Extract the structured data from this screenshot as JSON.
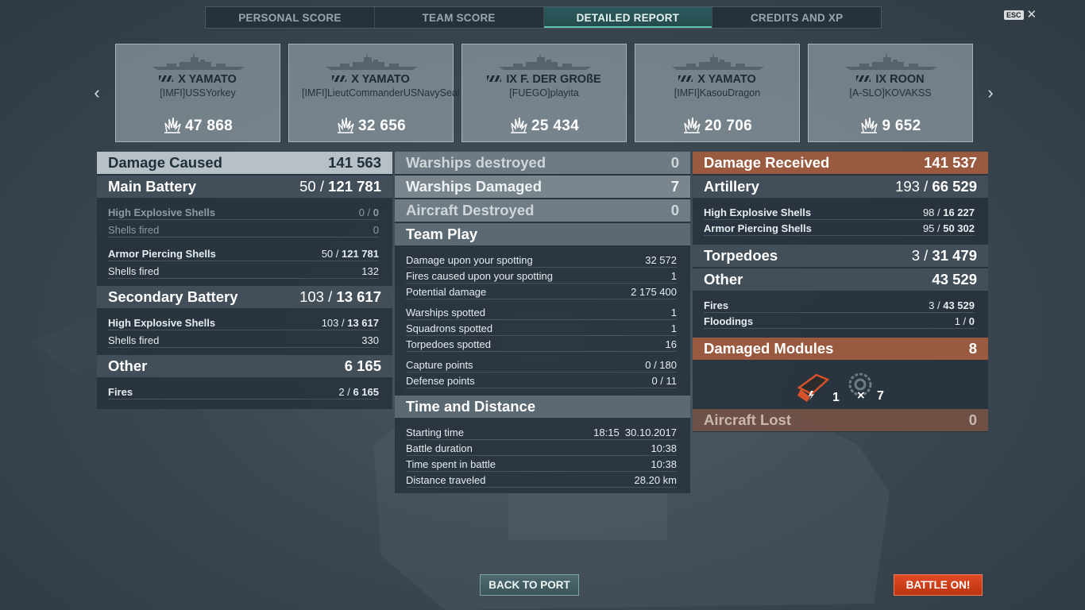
{
  "tabs": [
    "PERSONAL SCORE",
    "TEAM SCORE",
    "DETAILED REPORT",
    "CREDITS AND XP"
  ],
  "esc": {
    "key": "ESC",
    "close": "✕"
  },
  "nav": {
    "prev": "‹",
    "next": "›"
  },
  "players": [
    {
      "ship": "X YAMATO",
      "name": "[IMFI]USSYorkey",
      "damage": "47 868"
    },
    {
      "ship": "X YAMATO",
      "name": "[IMFI]LieutCommanderUSNavySeal",
      "damage": "32 656"
    },
    {
      "ship": "IX F. DER GROßE",
      "name": "[FUEGO]playita",
      "damage": "25 434"
    },
    {
      "ship": "X YAMATO",
      "name": "[IMFI]KasouDragon",
      "damage": "20 706"
    },
    {
      "ship": "IX ROON",
      "name": "[A-SLO]KOVAKSS",
      "damage": "9 652"
    }
  ],
  "left": {
    "damage_caused": {
      "label": "Damage Caused",
      "value": "141 563"
    },
    "main_battery": {
      "label": "Main Battery",
      "hits": "50 / ",
      "value": "121 781"
    },
    "he_main": {
      "label": "High Explosive Shells",
      "hits": "0 / ",
      "value": "0"
    },
    "he_main_fired": {
      "label": "Shells fired",
      "value": "0"
    },
    "ap_main": {
      "label": "Armor Piercing Shells",
      "hits": "50 / ",
      "value": "121 781"
    },
    "ap_main_fired": {
      "label": "Shells fired",
      "value": "132"
    },
    "secondary": {
      "label": "Secondary Battery",
      "hits": "103 / ",
      "value": "13 617"
    },
    "he_sec": {
      "label": "High Explosive Shells",
      "hits": "103 / ",
      "value": "13 617"
    },
    "he_sec_fired": {
      "label": "Shells fired",
      "value": "330"
    },
    "other": {
      "label": "Other",
      "value": "6 165"
    },
    "fires": {
      "label": "Fires",
      "hits": "2 / ",
      "value": "6 165"
    }
  },
  "middle": {
    "warships_destroyed": {
      "label": "Warships destroyed",
      "value": "0"
    },
    "warships_damaged": {
      "label": "Warships Damaged",
      "value": "7"
    },
    "aircraft_destroyed": {
      "label": "Aircraft Destroyed",
      "value": "0"
    },
    "team_play": "Team Play",
    "tp_rows": [
      {
        "label": "Damage upon your spotting",
        "value": "32 572"
      },
      {
        "label": "Fires caused upon your spotting",
        "value": "1"
      },
      {
        "label": "Potential damage",
        "value": "2 175 400"
      },
      {
        "label": "Warships spotted",
        "value": "1"
      },
      {
        "label": "Squadrons spotted",
        "value": "1"
      },
      {
        "label": "Torpedoes spotted",
        "value": "16"
      },
      {
        "label": "Capture points",
        "value": "0 / 180"
      },
      {
        "label": "Defense points",
        "value": "0 / 11"
      }
    ],
    "time_distance": "Time and Distance",
    "td_rows": [
      {
        "label": "Starting time",
        "value": "18:15  30.10.2017"
      },
      {
        "label": "Battle duration",
        "value": "10:38"
      },
      {
        "label": "Time spent in battle",
        "value": "10:38"
      },
      {
        "label": "Distance traveled",
        "value": "28.20 km"
      }
    ]
  },
  "right": {
    "damage_received": {
      "label": "Damage Received",
      "value": "141 537"
    },
    "artillery": {
      "label": "Artillery",
      "hits": "193 / ",
      "value": "66 529"
    },
    "he": {
      "label": "High Explosive Shells",
      "hits": "98 / ",
      "value": "16 227"
    },
    "ap": {
      "label": "Armor Piercing Shells",
      "hits": "95 / ",
      "value": "50 302"
    },
    "torpedoes": {
      "label": "Torpedoes",
      "hits": "3 / ",
      "value": "31 479"
    },
    "other": {
      "label": "Other",
      "value": "43 529"
    },
    "fires": {
      "label": "Fires",
      "hits": "3 / ",
      "value": "43 529"
    },
    "floodings": {
      "label": "Floodings",
      "hits": "1 / ",
      "value": "0"
    },
    "damaged_modules": {
      "label": "Damaged Modules",
      "value": "8"
    },
    "modules": [
      {
        "icon": "gun-turret-icon",
        "count": "1"
      },
      {
        "icon": "steering-gear-icon",
        "count": "7"
      }
    ],
    "aircraft_lost": {
      "label": "Aircraft Lost",
      "value": "0"
    }
  },
  "buttons": {
    "back": "BACK TO PORT",
    "battle": "BATTLE ON!"
  },
  "colors": {
    "accent_teal": "#5cc0b4",
    "battle_red": "#d2401a",
    "received_orange": "#9a5a3f"
  }
}
